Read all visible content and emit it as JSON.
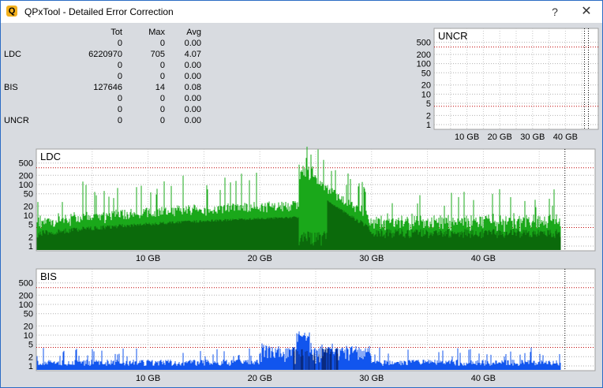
{
  "window": {
    "title": "QPxTool - Detailed Error Correction",
    "app_icon_letter": "Q",
    "help_label": "?",
    "close_label": "✕"
  },
  "stats": {
    "headers": [
      "",
      "Tot",
      "Max",
      "Avg"
    ],
    "rows": [
      [
        "",
        "0",
        "0",
        "0.00"
      ],
      [
        "LDC",
        "6220970",
        "705",
        "4.07"
      ],
      [
        "",
        "0",
        "0",
        "0.00"
      ],
      [
        "",
        "0",
        "0",
        "0.00"
      ],
      [
        "BIS",
        "127646",
        "14",
        "0.08"
      ],
      [
        "",
        "0",
        "0",
        "0.00"
      ],
      [
        "",
        "0",
        "0",
        "0.00"
      ],
      [
        "UNCR",
        "0",
        "0",
        "0.00"
      ]
    ]
  },
  "chart_data": [
    {
      "type": "bar",
      "title": "UNCR",
      "yscale": "log",
      "ytick_labels": [
        "500",
        "200",
        "100",
        "50",
        "20",
        "10",
        "5",
        "2",
        "1"
      ],
      "xtick_labels": [
        "10 GB",
        "20 GB",
        "30 GB",
        "40 GB"
      ],
      "xlim": [
        0,
        50
      ],
      "series": [],
      "grid": true,
      "threshold_color": "#c00000"
    },
    {
      "type": "bar",
      "title": "LDC",
      "yscale": "log",
      "ytick_labels": [
        "500",
        "200",
        "100",
        "50",
        "20",
        "10",
        "5",
        "2",
        "1"
      ],
      "xtick_labels": [
        "10 GB",
        "20 GB",
        "30 GB",
        "40 GB"
      ],
      "xlim": [
        0,
        50
      ],
      "x_end": 46.9,
      "colors": {
        "primary": "#1aa81a",
        "dark": "#0b6a0b",
        "bright": "#33cc33"
      },
      "grid": true,
      "threshold_color": "#c00000"
    },
    {
      "type": "bar",
      "title": "BIS",
      "yscale": "log",
      "ytick_labels": [
        "500",
        "200",
        "100",
        "50",
        "20",
        "10",
        "5",
        "2",
        "1"
      ],
      "xtick_labels": [
        "10 GB",
        "20 GB",
        "30 GB",
        "40 GB"
      ],
      "xlim": [
        0,
        50
      ],
      "x_end": 46.9,
      "colors": {
        "primary": "#1155ee",
        "dark": "#0a2a80"
      },
      "grid": true,
      "threshold_color": "#c00000"
    }
  ]
}
